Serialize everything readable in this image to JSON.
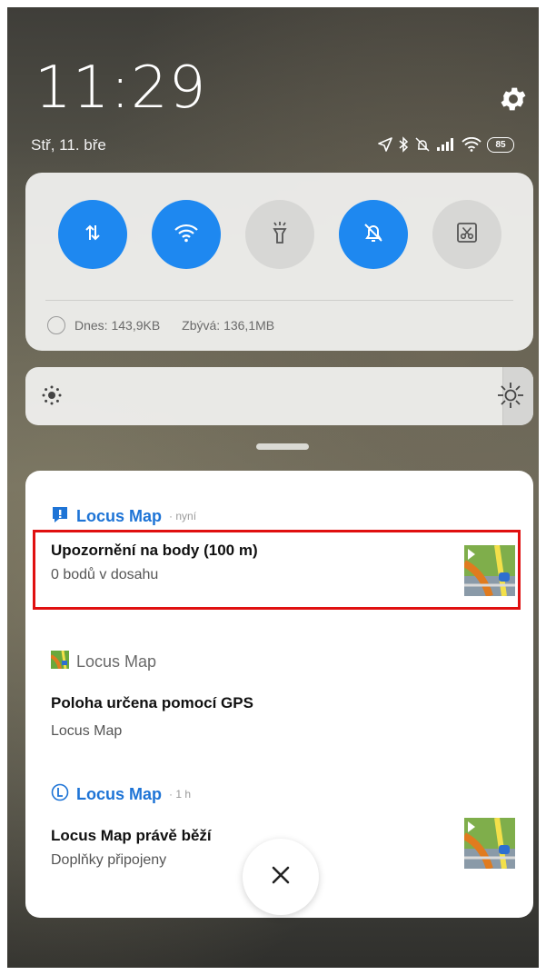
{
  "status": {
    "time": "11:29",
    "date": "Stř, 11. bře",
    "battery": "85",
    "icons": [
      "location-icon",
      "bluetooth-icon",
      "alarm-off-icon",
      "signal-icon",
      "wifi-icon",
      "battery-icon"
    ]
  },
  "quick_settings": {
    "toggles": [
      {
        "name": "mobile-data",
        "icon": "data-arrows-icon",
        "state": "on"
      },
      {
        "name": "wifi",
        "icon": "wifi-icon",
        "state": "on"
      },
      {
        "name": "flashlight",
        "icon": "flashlight-icon",
        "state": "off"
      },
      {
        "name": "silent",
        "icon": "bell-off-icon",
        "state": "on"
      },
      {
        "name": "screenshot",
        "icon": "scissors-icon",
        "state": "off"
      }
    ],
    "data_today": "Dnes: 143,9KB",
    "data_remaining": "Zbývá: 136,1MB"
  },
  "brightness": {
    "level": 0.94
  },
  "colors": {
    "accent": "#1e88f0",
    "highlight": "#e01010",
    "app_name": "#1e74d6"
  },
  "notifications": [
    {
      "app": "Locus Map",
      "when": "· nyní",
      "icon": "alert-icon",
      "title": "Upozornění na body (100 m)",
      "text": "0 bodů v dosahu",
      "has_thumb": true
    },
    {
      "app": "Locus Map",
      "when": "",
      "icon": "app-icon",
      "title": "Poloha určena pomocí GPS",
      "text": "Locus Map",
      "has_thumb": false
    },
    {
      "app": "Locus Map",
      "when": "· 1 h",
      "icon": "locus-l-icon",
      "title": "Locus Map právě běží",
      "text": "Doplňky připojeny",
      "has_thumb": true
    }
  ]
}
